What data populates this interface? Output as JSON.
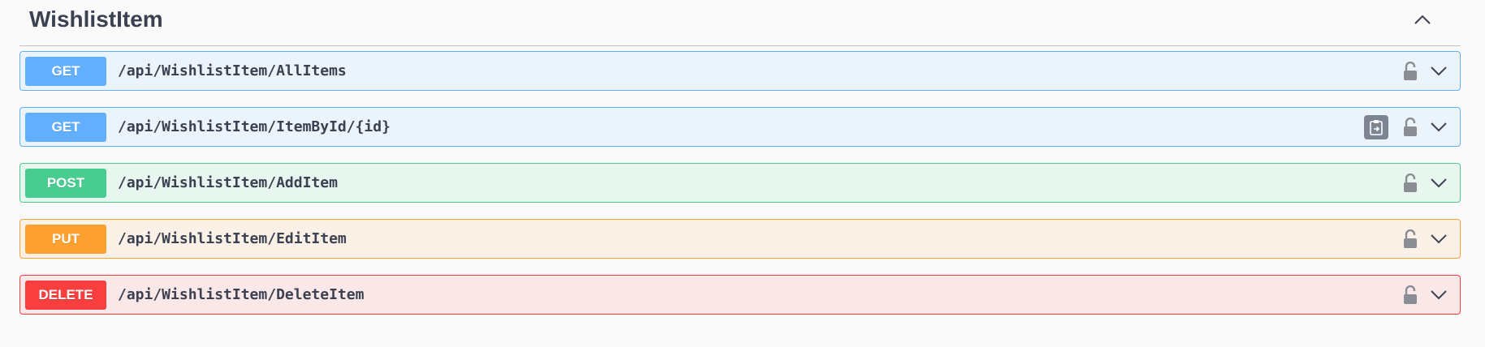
{
  "section": {
    "title": "WishlistItem",
    "toggle_icon": "chevron-up-icon"
  },
  "operations": [
    {
      "method": "GET",
      "path": "/api/WishlistItem/AllItems",
      "color": "#61affe",
      "bg": "#ebf3fb",
      "copy": false
    },
    {
      "method": "GET",
      "path": "/api/WishlistItem/ItemById/{id}",
      "color": "#61affe",
      "bg": "#ebf3fb",
      "copy": true
    },
    {
      "method": "POST",
      "path": "/api/WishlistItem/AddItem",
      "color": "#49cc90",
      "bg": "#e8f6f0",
      "copy": false
    },
    {
      "method": "PUT",
      "path": "/api/WishlistItem/EditItem",
      "color": "#fca130",
      "bg": "#fbf1e6",
      "copy": false
    },
    {
      "method": "DELETE",
      "path": "/api/WishlistItem/DeleteItem",
      "color": "#f93e3e",
      "bg": "#fae7e7",
      "copy": false
    }
  ],
  "icons": {
    "lock": "unlocked-padlock-icon",
    "expand": "chevron-down-icon",
    "copy": "copy-to-clipboard-icon"
  }
}
